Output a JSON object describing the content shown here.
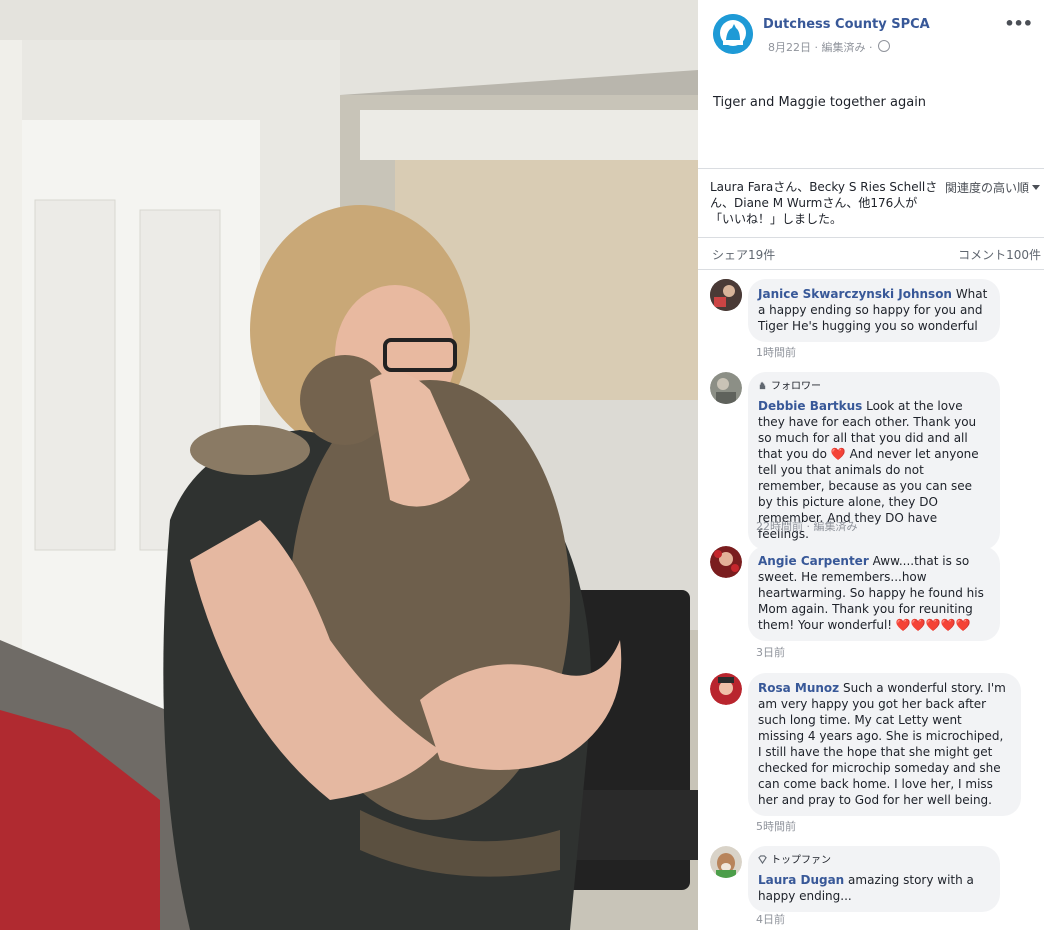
{
  "post": {
    "page_name": "Dutchess County SPCA",
    "meta": "8月22日 · 編集済み ·",
    "text": "Tiger and Maggie together again",
    "more_icon": "more-options-icon"
  },
  "reactions": {
    "likes_text": "Laura Faraさん、Becky S Ries Schellさん、Diane M Wurmさん、他176人が「いいね！」しました。",
    "sort_label": "関連度の高い順",
    "shares": "シェア19件",
    "comments": "コメント100件"
  },
  "comments": [
    {
      "name": "Janice Skwarczynski Johnson",
      "text": "What a happy ending so happy for you and Tiger He's hugging you so wonderful",
      "time": "1時間前",
      "badge": ""
    },
    {
      "name": "Debbie Bartkus",
      "text": "Look at the love they have for each other. Thank you so much for all that you did and all that you do ❤️ And never let anyone tell you that animals do not remember, because as you can see by this picture alone, they DO remember. And they DO have feelings.",
      "time": "22時間前 · 編集済み",
      "badge": "フォロワー"
    },
    {
      "name": "Angie Carpenter",
      "text": "Aww....that is so sweet. He remembers...how heartwarming. So happy he found his Mom again. Thank you for reuniting them! Your wonderful! ❤️❤️❤️❤️❤️",
      "time": "3日前",
      "badge": ""
    },
    {
      "name": "Rosa Munoz",
      "text": "Such a wonderful story. I'm am very happy you got her back after such long time. My cat Letty went missing 4 years ago. She is microchiped, I still have the hope that she might get checked for microchip someday and she can come back home. I love her, I miss her and pray to God for her well being.",
      "time": "5時間前",
      "badge": ""
    },
    {
      "name": "Laura Dugan",
      "text": "amazing story with a happy ending...",
      "time": "4日前",
      "badge": "トップファン"
    }
  ],
  "colors": {
    "link": "#385898",
    "bubble": "#f2f3f5",
    "muted": "#90949c",
    "accent": "#1e9ad6"
  }
}
